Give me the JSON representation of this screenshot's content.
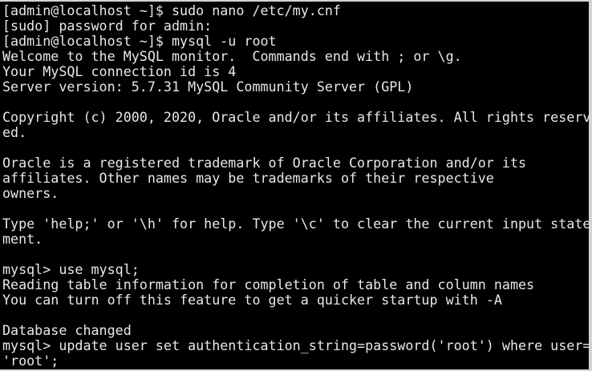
{
  "terminal": {
    "lines": [
      "[admin@localhost ~]$ sudo nano /etc/my.cnf",
      "[sudo] password for admin:",
      "[admin@localhost ~]$ mysql -u root",
      "Welcome to the MySQL monitor.  Commands end with ; or \\g.",
      "Your MySQL connection id is 4",
      "Server version: 5.7.31 MySQL Community Server (GPL)",
      "",
      "Copyright (c) 2000, 2020, Oracle and/or its affiliates. All rights reserv",
      "ed.",
      "",
      "Oracle is a registered trademark of Oracle Corporation and/or its",
      "affiliates. Other names may be trademarks of their respective",
      "owners.",
      "",
      "Type 'help;' or '\\h' for help. Type '\\c' to clear the current input state",
      "ment.",
      "",
      "mysql> use mysql;",
      "Reading table information for completion of table and column names",
      "You can turn off this feature to get a quicker startup with -A",
      "",
      "Database changed",
      "mysql> update user set authentication_string=password('root') where user=",
      "'root';"
    ]
  }
}
